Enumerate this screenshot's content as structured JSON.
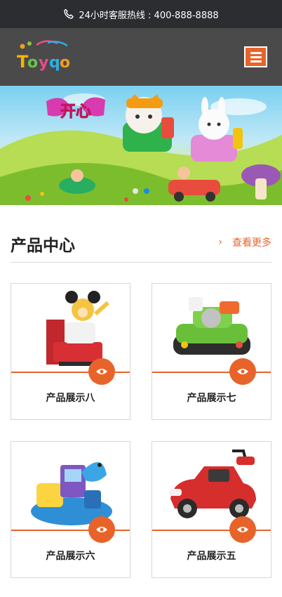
{
  "topbar": {
    "hotline": "24小时客服热线 : 400-888-8888",
    "icon": "phone-icon"
  },
  "header": {
    "logo_text": "Toyqo",
    "menu_icon": "hamburger-icon"
  },
  "banner": {
    "slide_text": "开心",
    "slides_count": 2,
    "active_slide": 2
  },
  "products_section": {
    "title": "产品中心",
    "more_label": "查看更多"
  },
  "products": [
    {
      "name": "产品展示八",
      "icon": "mickey-ride-icon"
    },
    {
      "name": "产品展示七",
      "icon": "tank-ride-icon"
    },
    {
      "name": "产品展示六",
      "icon": "dolphin-ride-icon"
    },
    {
      "name": "产品展示五",
      "icon": "red-car-icon"
    }
  ],
  "colors": {
    "accent": "#e8632a",
    "topbar": "#2b2d31",
    "header": "#4a4a4a",
    "dot_active": "#1a8fd8"
  }
}
